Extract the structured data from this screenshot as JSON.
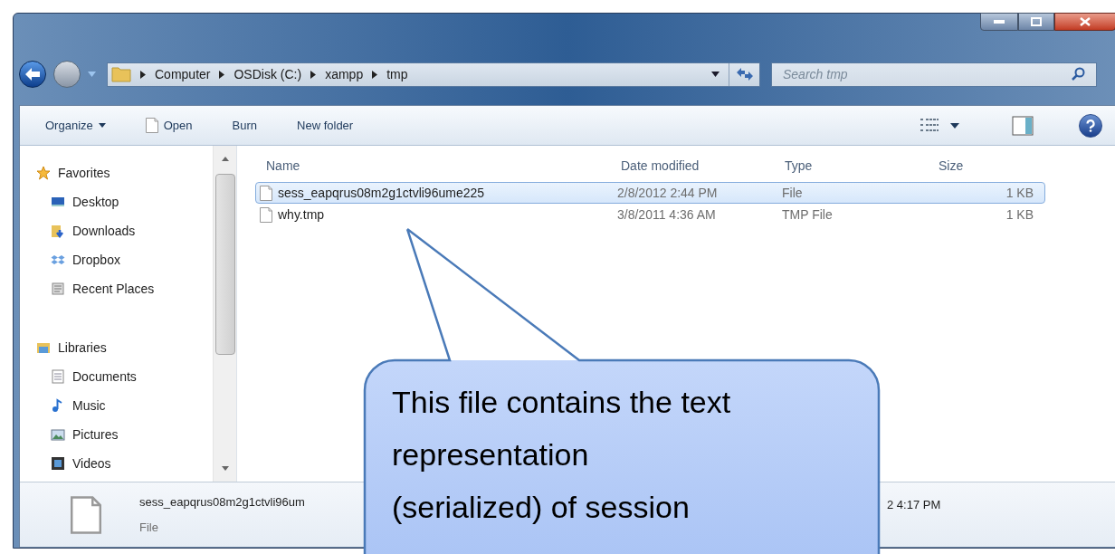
{
  "window": {
    "breadcrumb": [
      "Computer",
      "OSDisk (C:)",
      "xampp",
      "tmp"
    ],
    "search": {
      "placeholder": "Search tmp"
    }
  },
  "toolbar": {
    "items": [
      {
        "kind": "menu",
        "label": "Organize"
      },
      {
        "kind": "open",
        "label": "Open"
      },
      {
        "kind": "plain",
        "label": "Burn"
      },
      {
        "kind": "plain",
        "label": "New folder"
      }
    ]
  },
  "sidebar": {
    "groups": [
      {
        "label": "Favorites",
        "children": [
          {
            "label": "Desktop"
          },
          {
            "label": "Downloads"
          },
          {
            "label": "Dropbox"
          },
          {
            "label": "Recent Places"
          }
        ]
      },
      {
        "label": "Libraries",
        "children": [
          {
            "label": "Documents"
          },
          {
            "label": "Music"
          },
          {
            "label": "Pictures"
          },
          {
            "label": "Videos"
          }
        ]
      }
    ]
  },
  "table": {
    "columns": [
      "Name",
      "Date modified",
      "Type",
      "Size"
    ],
    "rows": [
      {
        "name": "sess_eapqrus08m2g1ctvli96ume225",
        "date": "2/8/2012 2:44 PM",
        "type": "File",
        "size": "1 KB",
        "selected": true
      },
      {
        "name": "why.tmp",
        "date": "3/8/2011 4:36 AM",
        "type": "TMP File",
        "size": "1 KB",
        "selected": false
      }
    ]
  },
  "details": {
    "name": "sess_eapqrus08m2g1ctvli96um",
    "type": "File",
    "date": "2 4:17 PM"
  },
  "callout": {
    "lines": [
      "This file contains the text",
      "representation",
      "(serialized) of session"
    ]
  }
}
